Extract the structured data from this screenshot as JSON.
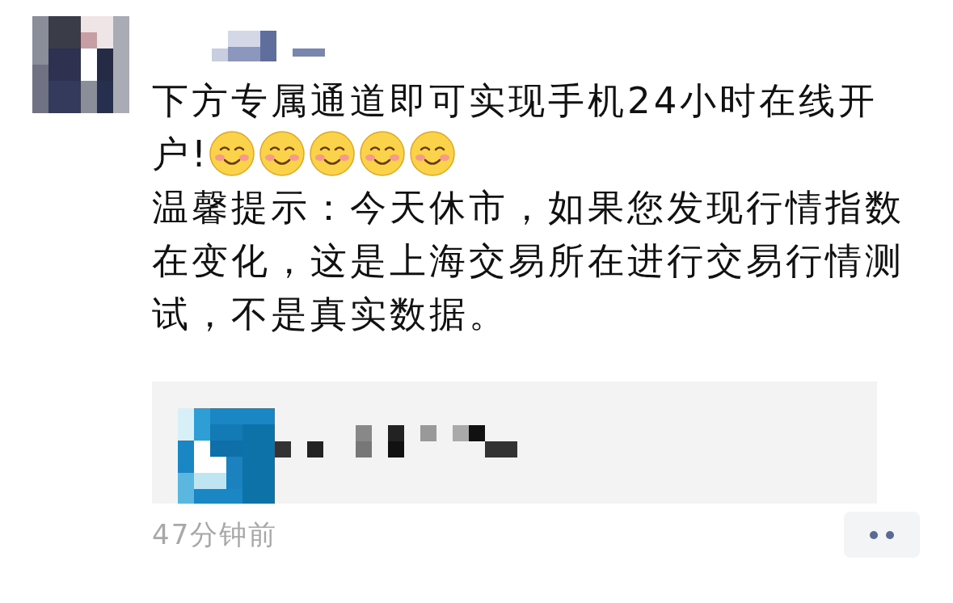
{
  "post": {
    "author": {
      "kind": "redacted"
    },
    "paragraphs": [
      {
        "text": "下方专属通道即可实现手机24小时在线开户!",
        "emojis": [
          {
            "kind": "smile"
          },
          {
            "kind": "smile"
          },
          {
            "kind": "smile"
          },
          {
            "kind": "smile"
          },
          {
            "kind": "smile"
          }
        ]
      },
      {
        "text": "温馨提示：今天休市，如果您发现行情指数在变化，这是上海交易所在进行交易行情测试，不是真实数据。"
      }
    ],
    "link_card": {
      "title": {
        "kind": "redacted"
      }
    },
    "time": "47分钟前"
  }
}
